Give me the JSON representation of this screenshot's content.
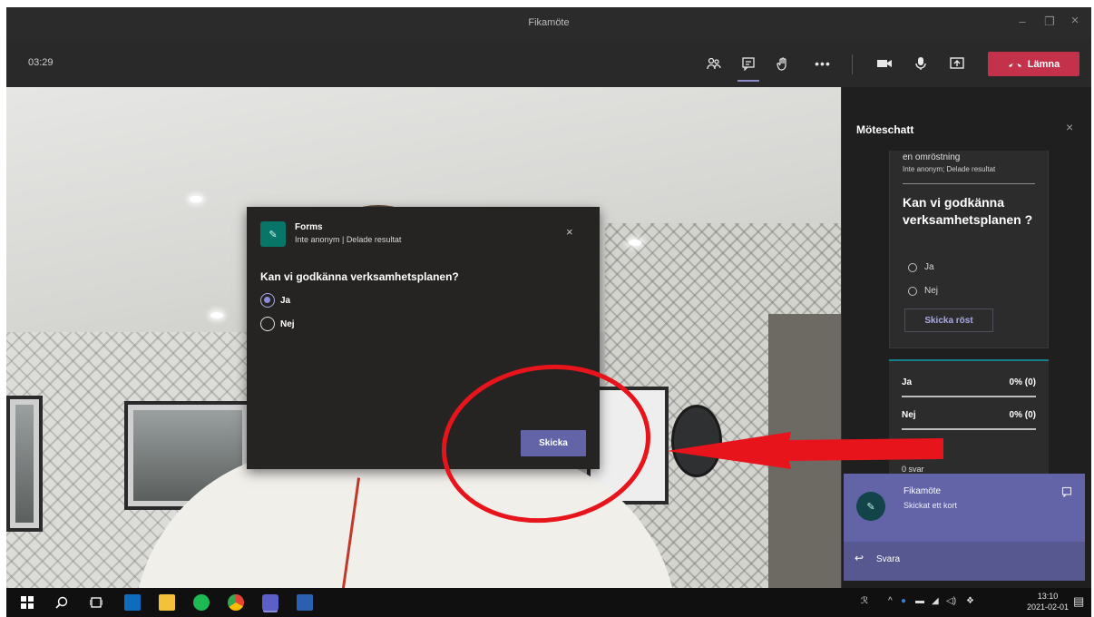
{
  "window": {
    "title": "Fikamöte",
    "minimize": "–",
    "maximize": "❐",
    "close": "×"
  },
  "toolbar": {
    "timer": "03:29",
    "leave_label": "Lämna"
  },
  "dialog": {
    "app_name": "Forms",
    "subtitle": "Inte anonym | Delade resultat",
    "question": "Kan vi godkänna verksamhetsplanen?",
    "options": [
      {
        "label": "Ja",
        "selected": true
      },
      {
        "label": "Nej",
        "selected": false
      }
    ],
    "submit_label": "Skicka",
    "close": "×"
  },
  "chat": {
    "title": "Möteschatt",
    "close": "×",
    "poll_card": {
      "header_line1": "en omröstning",
      "header_line2": "Inte anonym; Delade resultat",
      "question": "Kan vi godkänna verksamhetsplanen ?",
      "options": [
        "Ja",
        "Nej"
      ],
      "vote_label": "Skicka röst"
    },
    "results_card": {
      "rows": [
        {
          "label": "Ja",
          "value": "0% (0)"
        },
        {
          "label": "Nej",
          "value": "0% (0)"
        }
      ],
      "total": "0 svar"
    }
  },
  "toast": {
    "title": "Fikamöte",
    "subtitle": "Skickat ett kort",
    "reply_label": "Svara"
  },
  "taskbar": {
    "time": "13:10",
    "date": "2021-02-01"
  },
  "colors": {
    "accent": "#6264a7",
    "leave": "#c4314b",
    "annotation": "#e8141b"
  }
}
